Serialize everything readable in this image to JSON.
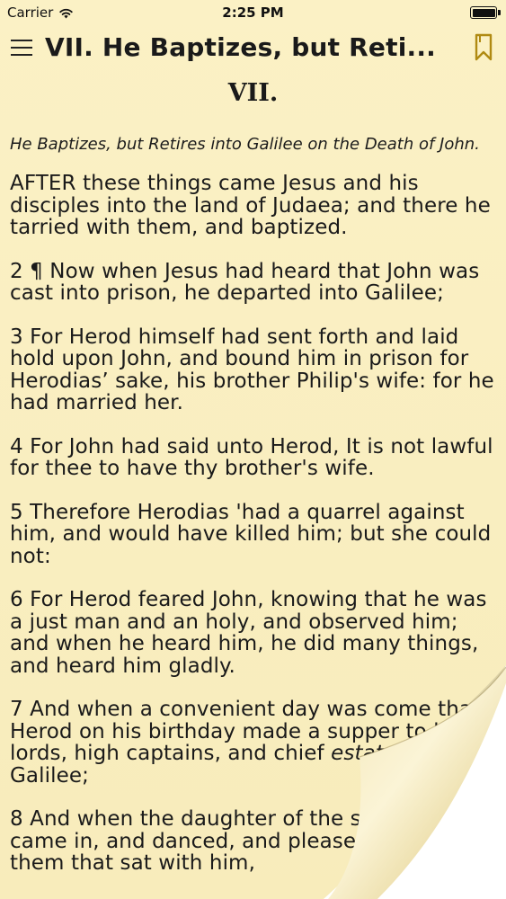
{
  "status_bar": {
    "carrier": "Carrier",
    "time": "2:25 PM"
  },
  "nav": {
    "title": "VII. He Baptizes, but Reti...",
    "menu_icon": "hamburger-menu-icon",
    "bookmark_icon": "bookmark-icon"
  },
  "chapter": {
    "heading": "VII.",
    "subtitle": "He Baptizes, but Retires into Galilee on the Death of John."
  },
  "verses": [
    {
      "text": "AFTER these things came Jesus and his disciples into the land of Judaea; and there he tarried with them, and baptized."
    },
    {
      "text": "2 ¶ Now when Jesus had heard that John was cast into prison, he departed into Galilee;"
    },
    {
      "text": "3 For Herod himself had sent forth and laid hold upon John, and bound him in prison for Herodias’ sake, his brother Philip's wife: for he had married her."
    },
    {
      "text": "4 For John had said unto Herod, It is not lawful for thee to have thy brother's wife."
    },
    {
      "text": "5 Therefore Herodias 'had a quarrel against him, and would have killed him; but she could not:"
    },
    {
      "text": "6 For Herod feared John, knowing that he was a just man and an holy, and observed him; and when he heard him, he did many things, and heard him gladly."
    },
    {
      "text_before": "7 And when a convenient day was come that Herod on his birthday made a supper to his lords, high captains, and chief ",
      "italic": "estates",
      "text_after": " of Galilee;"
    },
    {
      "text": "8 And when the daughter of the said Herodias came in, and danced, and pleased Herod and them that sat with him,"
    }
  ],
  "colors": {
    "paper": "#fbf1c4",
    "text": "#1a1a1a",
    "bookmark_accent": "#b08a12"
  }
}
